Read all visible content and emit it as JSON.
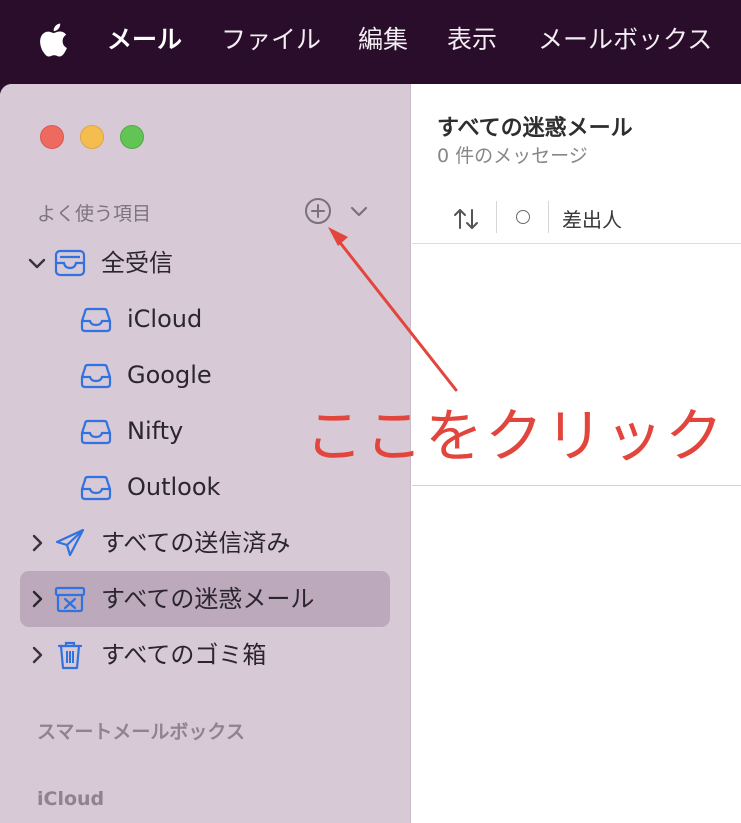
{
  "menubar": {
    "apple_icon": "apple-logo-icon",
    "items": [
      "メール",
      "ファイル",
      "編集",
      "表示",
      "メールボックス"
    ]
  },
  "sidebar": {
    "favorites_header": "よく使う項目",
    "favorites_icons": {
      "add": "plus-circle-icon",
      "collapse": "chevron-down-icon"
    },
    "items": [
      {
        "label": "全受信",
        "icon": "inbox-icon",
        "expanded": true
      },
      {
        "label": "iCloud",
        "icon": "inbox-icon"
      },
      {
        "label": "Google",
        "icon": "inbox-icon"
      },
      {
        "label": "Nifty",
        "icon": "inbox-icon"
      },
      {
        "label": "Outlook",
        "icon": "inbox-icon"
      },
      {
        "label": "すべての送信済み",
        "icon": "paper-plane-icon",
        "expanded": false
      },
      {
        "label": "すべての迷惑メール",
        "icon": "junk-tray-icon",
        "expanded": false,
        "selected": true
      },
      {
        "label": "すべてのゴミ箱",
        "icon": "trash-icon",
        "expanded": false
      }
    ],
    "smart_mailboxes_header": "スマートメールボックス",
    "icloud_header": "iCloud"
  },
  "message_list": {
    "title": "すべての迷惑メール",
    "count": "0 件のメッセージ",
    "columns": {
      "sort_icon": "sort-arrows-icon",
      "status_icon": "circle-icon",
      "sender": "差出人"
    }
  },
  "annotation": {
    "text": "ここをクリック",
    "color": "#e2453c"
  },
  "colors": {
    "menubar_bg": "#2a0d2b",
    "sidebar_bg": "#d8c9d7",
    "selected_row": "#bca9bb",
    "accent_icon": "#2f72e0"
  }
}
